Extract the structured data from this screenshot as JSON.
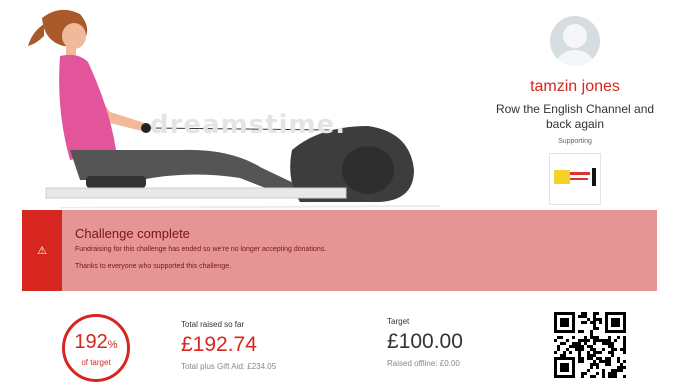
{
  "profile": {
    "name": "tamzin jones",
    "challenge_line1": "Row the English Channel and",
    "challenge_line2": "back again",
    "supporting_label": "Supporting"
  },
  "hero": {
    "watermark": "dreamstime."
  },
  "banner": {
    "icon": "warning-icon",
    "title": "Challenge complete",
    "line1": "Fundraising for this challenge has ended so we're no longer accepting donations.",
    "line2": "Thanks to everyone who supported this challenge."
  },
  "stats": {
    "percent": "192",
    "percent_sign": "%",
    "percent_sub": "of target",
    "raised_label": "Total raised so far",
    "raised_amount": "£192.74",
    "raised_gift": "Total plus Gift Aid: £234.05",
    "target_label": "Target",
    "target_amount": "£100.00",
    "target_offline": "Raised offline: £0.00"
  },
  "colors": {
    "brand_red": "#d6261f",
    "banner_bg": "#e69597"
  }
}
